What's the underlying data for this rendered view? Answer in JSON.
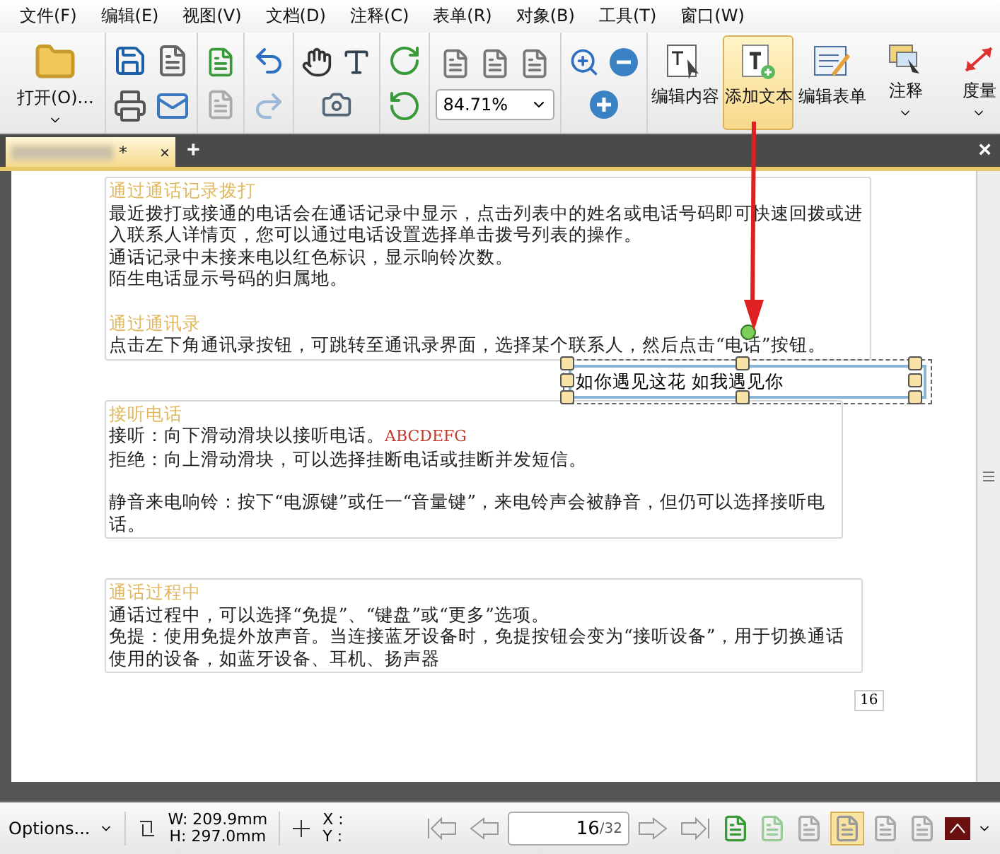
{
  "menu": [
    "文件(F)",
    "编辑(E)",
    "视图(V)",
    "文档(D)",
    "注释(C)",
    "表单(R)",
    "对象(B)",
    "工具(T)",
    "窗口(W)"
  ],
  "toolbar": {
    "open_label": "打开(O)...",
    "zoom_value": "84.71%",
    "tools": [
      {
        "label": "编辑内容",
        "selected": false,
        "dropdown": false
      },
      {
        "label": "添加文本",
        "selected": true,
        "dropdown": false
      },
      {
        "label": "编辑表单",
        "selected": false,
        "dropdown": false
      },
      {
        "label": "注释",
        "selected": false,
        "dropdown": true
      },
      {
        "label": "度量",
        "selected": false,
        "dropdown": true
      }
    ]
  },
  "tabs": [
    {
      "modified_mark": "*",
      "close": "×",
      "selected": true
    }
  ],
  "new_tab": "+",
  "close_all": "×",
  "document": {
    "boxes": [
      {
        "sections": [
          {
            "heading": "通过通话记录拨打",
            "paragraphs": [
              {
                "text": "最近拨打或接通的电话会在通话记录中显示，点击列表中的姓名或电话号码即可快速回拨或进入联系人详情页，您可以通过电话设置选择单击拨号列表的操作。",
                "spaced": false
              },
              {
                "text": "通话记录中未接来电以红色标识，显示响铃次数。",
                "spaced": false
              },
              {
                "text": "陌生电话显示号码的归属地。",
                "spaced": false
              }
            ]
          },
          {
            "heading": "通过通讯录",
            "paragraphs": [
              {
                "text": "点击左下角通讯录按钮，可跳转至通讯录界面，选择某个联系人，然后点击“电话”按钮。",
                "spaced": false
              }
            ]
          }
        ]
      },
      {
        "sections": [
          {
            "heading": "接听电话",
            "paragraphs": [
              {
                "text": "接听：向下滑动滑块以接听电话。",
                "suffix": "ABCDEFG",
                "spaced": false
              },
              {
                "text": "拒绝：向上滑动滑块，可以选择挂断电话或挂断并发短信。",
                "spaced": false
              },
              {
                "text": "静音来电响铃：按下“电源键”或任一“音量键”，来电铃声会被静音，但仍可以选择接听电话。",
                "spaced": true
              }
            ]
          }
        ]
      },
      {
        "sections": [
          {
            "heading": "通话过程中",
            "paragraphs": [
              {
                "text": "通话过程中，可以选择“免提”、“键盘”或“更多”选项。",
                "spaced": false
              },
              {
                "text": "免提：使用免提外放声音。当连接蓝牙设备时，免提按钮会变为“接听设备”，用于切换通话使用的设备，如蓝牙设备、耳机、扬声器",
                "spaced": false
              }
            ]
          }
        ]
      }
    ],
    "annotation": {
      "value": "如你遇见这花 如我遇见你"
    },
    "page_number": "16"
  },
  "status_bar": {
    "options": "Options...",
    "width": "W: 209.9mm",
    "height": "H: 297.0mm",
    "x": "X :",
    "y": "Y :",
    "page": "16",
    "page_total": "/32"
  }
}
